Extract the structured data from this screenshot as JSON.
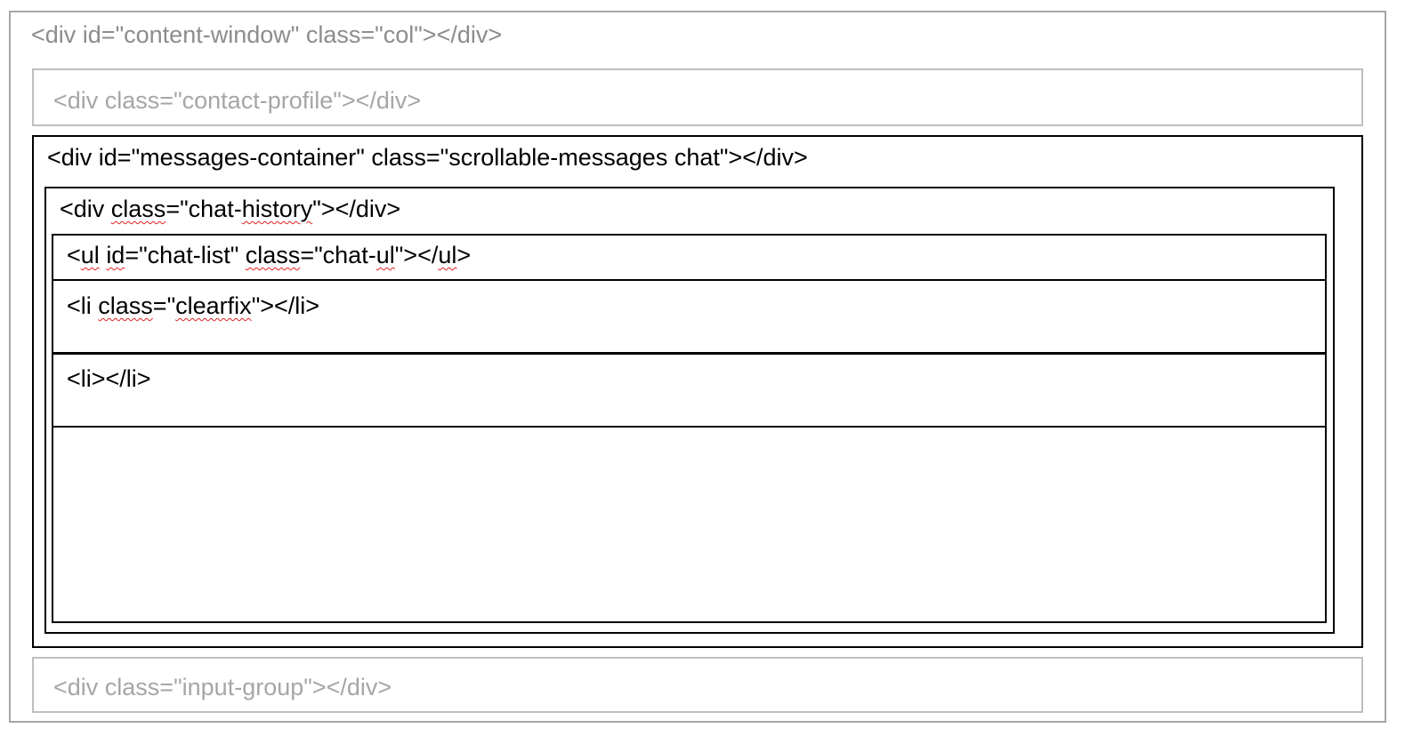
{
  "outer": {
    "label": "<div id=\"content-window\" class=\"col\"></div>"
  },
  "contact_profile": {
    "label": "<div class=\"contact-profile\"></div>"
  },
  "messages_container": {
    "label": "<div id=\"messages-container\" class=\"scrollable-messages chat\"></div>"
  },
  "chat_history": {
    "label_parts": [
      "<div ",
      "class",
      "=\"chat-",
      "history",
      "\"></div>"
    ]
  },
  "chat_list": {
    "label_parts": [
      "<",
      "ul",
      " ",
      "id",
      "=\"chat-list\" ",
      "class",
      "=\"chat-",
      "ul",
      "\"></",
      "ul",
      ">"
    ]
  },
  "li_clearfix": {
    "label_parts": [
      "<li ",
      "class",
      "=\"",
      "clearfix",
      "\"></li>"
    ]
  },
  "li_plain": {
    "label": "<li></li>"
  },
  "input_group": {
    "label": "<div class=\"input-group\"></div>"
  }
}
